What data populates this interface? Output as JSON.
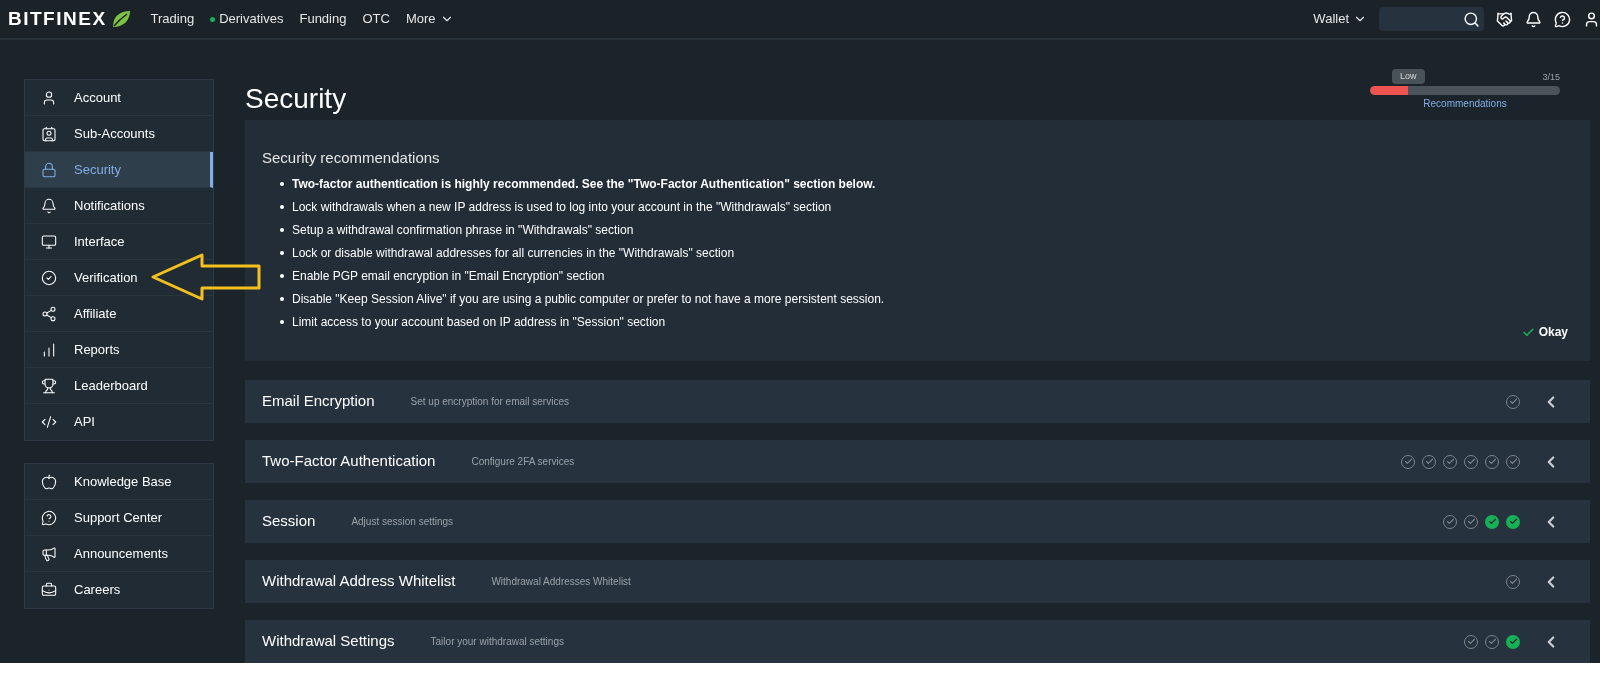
{
  "topbar": {
    "logo": "BITFINEX",
    "nav": [
      {
        "label": "Trading",
        "dot": false
      },
      {
        "label": "Derivatives",
        "dot": true
      },
      {
        "label": "Funding",
        "dot": false
      },
      {
        "label": "OTC",
        "dot": false
      },
      {
        "label": "More",
        "dot": false
      }
    ],
    "wallet": "Wallet"
  },
  "sidebar": {
    "groups": [
      [
        {
          "label": "Account",
          "selected": false
        },
        {
          "label": "Sub-Accounts",
          "selected": false
        },
        {
          "label": "Security",
          "selected": true
        },
        {
          "label": "Notifications",
          "selected": false
        },
        {
          "label": "Interface",
          "selected": false
        },
        {
          "label": "Verification",
          "selected": false
        },
        {
          "label": "Affiliate",
          "selected": false
        },
        {
          "label": "Reports",
          "selected": false
        },
        {
          "label": "Leaderboard",
          "selected": false
        },
        {
          "label": "API",
          "selected": false
        }
      ],
      [
        {
          "label": "Knowledge Base",
          "selected": false
        },
        {
          "label": "Support Center",
          "selected": false
        },
        {
          "label": "Announcements",
          "selected": false
        },
        {
          "label": "Careers",
          "selected": false
        }
      ]
    ]
  },
  "page": {
    "title": "Security",
    "score": {
      "tooltip": "Low",
      "count": "3/15",
      "level": 0.2,
      "link": "Recommendations"
    }
  },
  "recommendations": {
    "title": "Security recommendations",
    "items": [
      {
        "text": "Two-factor authentication is highly recommended. See the \"Two-Factor Authentication\" section below.",
        "bold": true
      },
      {
        "text": "Lock withdrawals when a new IP address is used to log into your account in the \"Withdrawals\" section",
        "bold": false
      },
      {
        "text": "Setup a withdrawal confirmation phrase in \"Withdrawals\" section",
        "bold": false
      },
      {
        "text": "Lock or disable withdrawal addresses for all currencies in the \"Withdrawals\" section",
        "bold": false
      },
      {
        "text": "Enable PGP email encryption in \"Email Encryption\" section",
        "bold": false
      },
      {
        "text": "Disable \"Keep Session Alive\" if you are using a public computer or prefer to not have a more persistent session.",
        "bold": false
      },
      {
        "text": "Limit access to your account based on IP address in \"Session\" section",
        "bold": false
      }
    ],
    "button": "Okay"
  },
  "sections": [
    {
      "title": "Email Encryption",
      "subtitle": "Set up encryption for email services",
      "steps": [
        {
          "completed": false
        }
      ]
    },
    {
      "title": "Two-Factor Authentication",
      "subtitle": "Configure 2FA services",
      "steps": [
        {
          "completed": false
        },
        {
          "completed": false
        },
        {
          "completed": false
        },
        {
          "completed": false
        },
        {
          "completed": false
        },
        {
          "completed": false
        }
      ]
    },
    {
      "title": "Session",
      "subtitle": "Adjust session settings",
      "steps": [
        {
          "completed": false
        },
        {
          "completed": false
        },
        {
          "completed": true
        },
        {
          "completed": true
        }
      ]
    },
    {
      "title": "Withdrawal Address Whitelist",
      "subtitle": "Withdrawal Addresses Whitelist",
      "steps": [
        {
          "completed": false
        }
      ]
    },
    {
      "title": "Withdrawal Settings",
      "subtitle": "Tailor your withdrawal settings",
      "steps": [
        {
          "completed": false
        },
        {
          "completed": false
        },
        {
          "completed": true
        }
      ]
    }
  ]
}
